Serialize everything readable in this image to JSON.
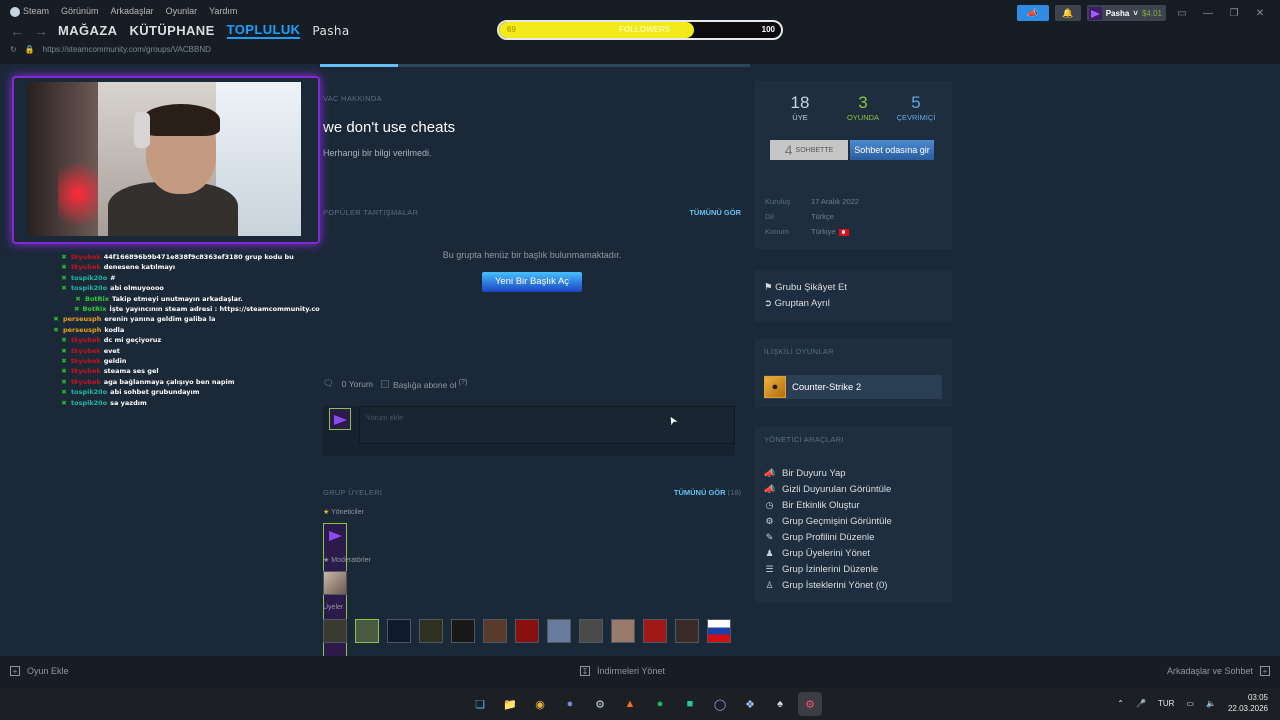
{
  "menu": {
    "steam": "Steam",
    "view": "Görünüm",
    "friends": "Arkadaşlar",
    "games": "Oyunlar",
    "help": "Yardım"
  },
  "nav": {
    "store": "MAĞAZA",
    "library": "KÜTÜPHANE",
    "community": "TOPLULUK",
    "user": "Pasha"
  },
  "url": "https://steamcommunity.com/groups/VACBBND",
  "followers": {
    "current": "69",
    "label": "FOLLOWERS",
    "goal": "100",
    "progress": 0.69
  },
  "account": {
    "name": "Pasha",
    "balance": "$4.01"
  },
  "chat": [
    {
      "user": "tkyubek",
      "msg": "44f166896b9b471e838f9c8363ef3180 grup kodu bu",
      "color": "#c0151f"
    },
    {
      "user": "tkyubek",
      "msg": "denesene katılmayı",
      "color": "#c0151f"
    },
    {
      "user": "tospik20o",
      "msg": "#",
      "color": "#1fb8a8"
    },
    {
      "user": "tospik20o",
      "msg": "abi olmuyoooo",
      "color": "#1fb8a8"
    },
    {
      "user": "BotRix",
      "msg": "Takip etmeyi unutmayın arkadaşlar.",
      "color": "#2ecc40"
    },
    {
      "user": "BotRix",
      "msg": "İşte yayıncının steam adresi : https://steamcommunity.com/id/athernas/",
      "color": "#2ecc40"
    },
    {
      "user": "perseusph",
      "msg": "erenin yanına geldim galiba la",
      "color": "#e8a317"
    },
    {
      "user": "perseusph",
      "msg": "kodla",
      "color": "#e8a317"
    },
    {
      "user": "tkyubek",
      "msg": "dc mi geçiyoruz",
      "color": "#c0151f"
    },
    {
      "user": "tkyubek",
      "msg": "evet",
      "color": "#c0151f"
    },
    {
      "user": "tkyubek",
      "msg": "geldin",
      "color": "#c0151f"
    },
    {
      "user": "tkyubek",
      "msg": "steama ses gel",
      "color": "#c0151f"
    },
    {
      "user": "tkyubek",
      "msg": "aga bağlanmaya çalışıyo ben napim",
      "color": "#c0151f"
    },
    {
      "user": "tospik20o",
      "msg": "abi sohbet grubundayım",
      "color": "#1fb8a8"
    },
    {
      "user": "tospik20o",
      "msg": "sa yazdım",
      "color": "#1fb8a8"
    }
  ],
  "about": {
    "heading": "VAC HAKKINDA",
    "title": "we don't use cheats",
    "text": "Herhangi bir bilgi verilmedi."
  },
  "discussions": {
    "heading": "POPÜLER TARTIŞMALAR",
    "see_all": "TÜMÜNÜ GÖR",
    "empty": "Bu grupta henüz bir başlık bulunmamaktadır.",
    "new_button": "Yeni Bir Başlık Aç"
  },
  "comments": {
    "count": "0 Yorum",
    "subscribe": "Başlığa abone ol",
    "help": "(?)",
    "placeholder": "Yorum ekle"
  },
  "members": {
    "heading": "GRUP ÜYELERİ",
    "see_all": "TÜMÜNÜ GÖR",
    "count": "(18)",
    "admins": "Yöneticiler",
    "mods": "Moderatörler",
    "members": "Üyeler"
  },
  "stats": [
    {
      "value": "18",
      "label": "ÜYE",
      "color": "#c6d4df"
    },
    {
      "value": "3",
      "label": "OYUNDA",
      "color": "#8bc53f"
    },
    {
      "value": "5",
      "label": "ÇEVRİMİÇİ",
      "color": "#62a7e3"
    }
  ],
  "group_chat": {
    "count": "4",
    "count_label": "SOHBETTE",
    "join": "Sohbet odasına gir"
  },
  "info": [
    {
      "key": "Kuruluş",
      "value": "17 Aralık 2022"
    },
    {
      "key": "Dil",
      "value": "Türkçe"
    },
    {
      "key": "Konum",
      "value": "Türkiye"
    }
  ],
  "actions": {
    "report": "Grubu Şikâyet Et",
    "leave": "Gruptan Ayrıl"
  },
  "related": {
    "heading": "İLİŞKİLİ OYUNLAR",
    "game": "Counter-Strike 2"
  },
  "admin_tools": {
    "heading": "YÖNETİCİ ARAÇLARI",
    "items": [
      "Bir Duyuru Yap",
      "Gizli Duyuruları Görüntüle",
      "Bir Etkinlik Oluştur",
      "Grup Geçmişini Görüntüle",
      "Grup Profilini Düzenle",
      "Grup Üyelerini Yönet",
      "Grup İzinlerini Düzenle",
      "Grup İsteklerini Yönet (0)"
    ]
  },
  "bottom": {
    "add_game": "Oyun Ekle",
    "downloads": "İndirmeleri Yönet",
    "friends": "Arkadaşlar ve Sohbet"
  },
  "taskbar": {
    "lang": "TUR",
    "time": "03:05",
    "date": "22.03.2026"
  }
}
